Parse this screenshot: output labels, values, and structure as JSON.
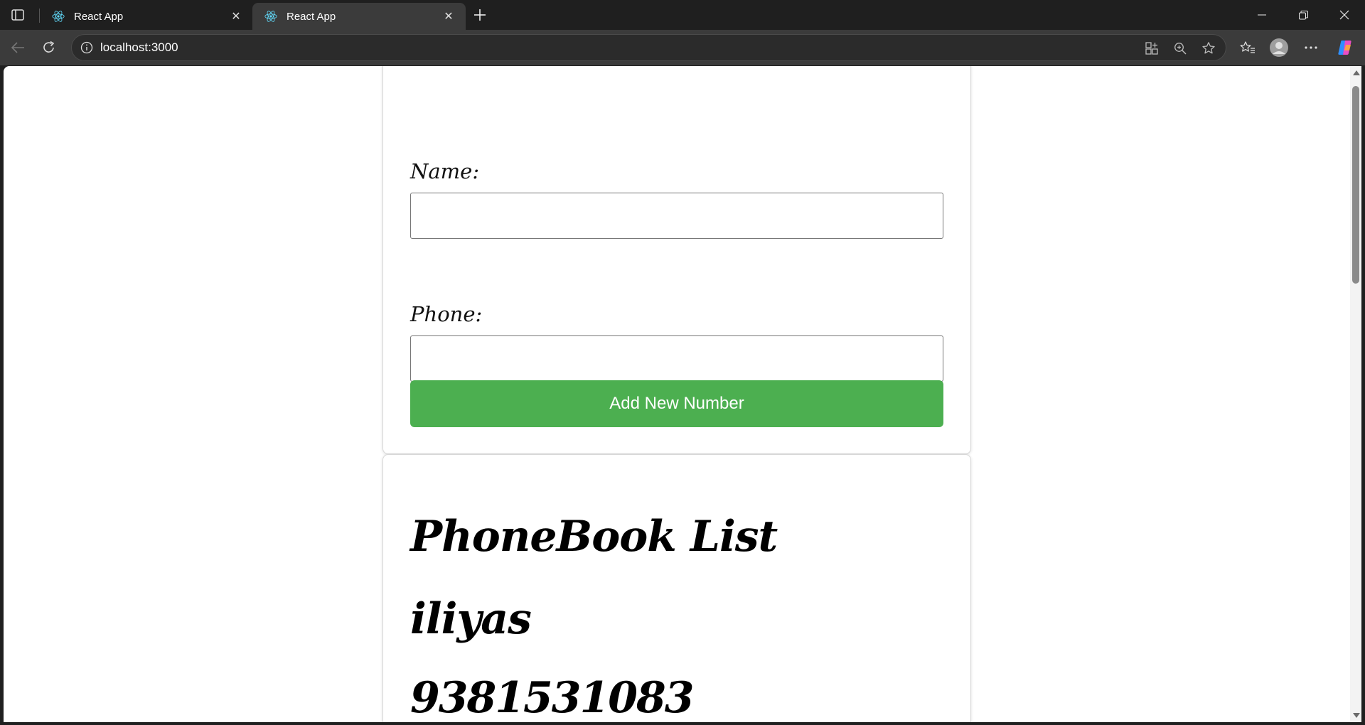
{
  "browser": {
    "tabs": [
      {
        "title": "React App",
        "active": false
      },
      {
        "title": "React App",
        "active": true
      }
    ],
    "address_bar": {
      "url": "localhost:3000"
    },
    "colors": {
      "react_logo": "#61dafb"
    }
  },
  "form": {
    "name_label": "Name:",
    "name_value": "",
    "phone_label": "Phone:",
    "phone_value": "",
    "add_button_label": "Add New Number",
    "button_color": "#4caf50"
  },
  "phonebook": {
    "title": "PhoneBook List",
    "entries": [
      {
        "name": "iliyas",
        "phone": "9381531083"
      }
    ]
  }
}
